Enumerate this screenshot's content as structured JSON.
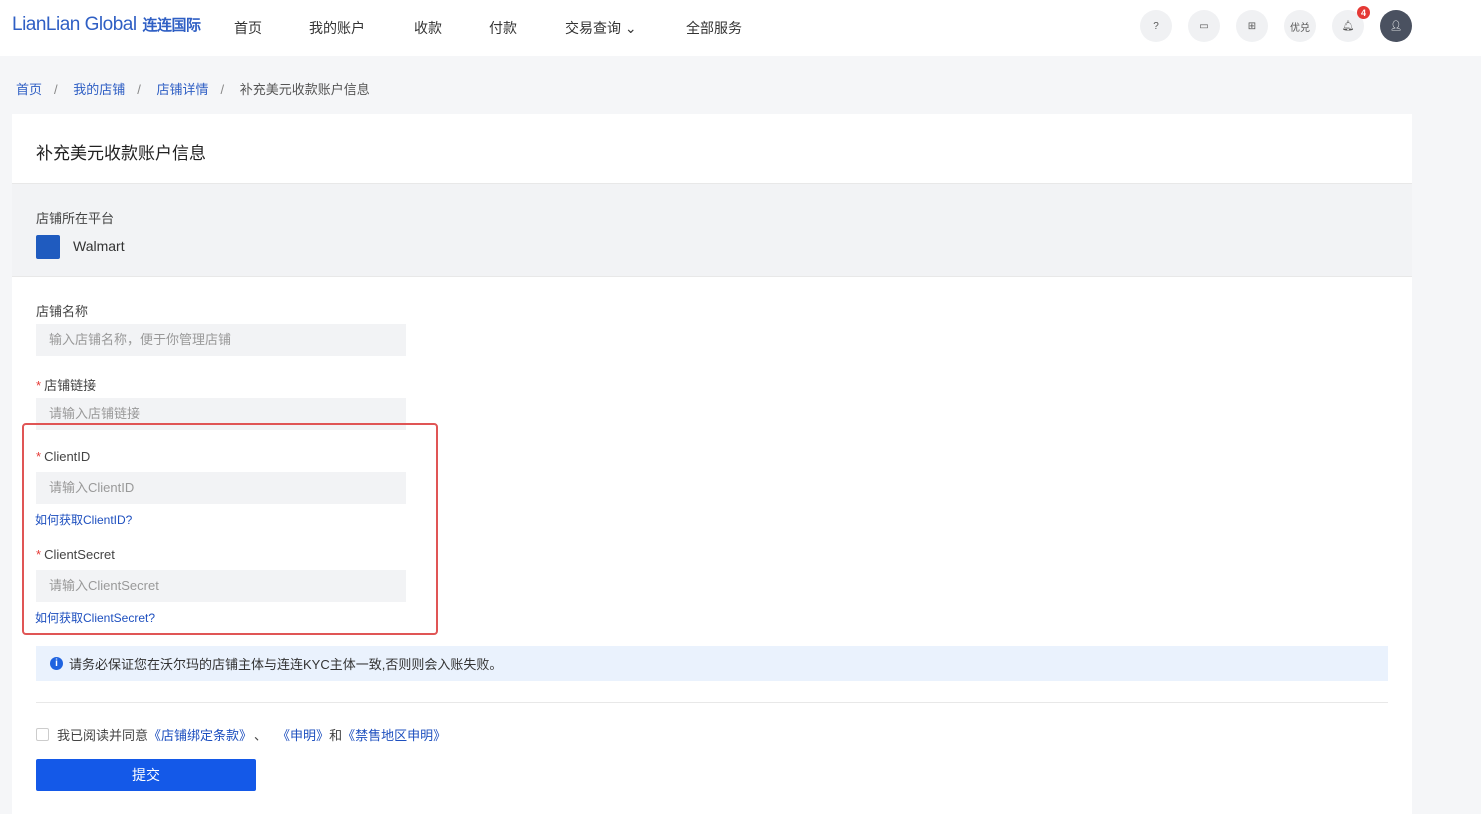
{
  "brand": {
    "logo_en": "LianLian Global",
    "logo_cn": "连连国际"
  },
  "nav": [
    "首页",
    "我的账户",
    "收款",
    "付款",
    "交易查询",
    "全部服务"
  ],
  "header": {
    "redeem": "优兑",
    "notif_count": "4"
  },
  "breadcrumb": [
    "首页",
    "我的店铺",
    "店铺详情",
    "补充美元收款账户信息"
  ],
  "page_title": "补充美元收款账户信息",
  "platform": {
    "label": "店铺所在平台",
    "name": "Walmart"
  },
  "form": {
    "store_name": {
      "label": "店铺名称",
      "placeholder": "输入店铺名称，便于你管理店铺"
    },
    "store_link": {
      "label": "店铺链接",
      "placeholder": "请输入店铺链接"
    },
    "client_id": {
      "label": "ClientID",
      "placeholder": "请输入ClientID",
      "help": "如何获取ClientID?"
    },
    "client_secret": {
      "label": "ClientSecret",
      "placeholder": "请输入ClientSecret",
      "help": "如何获取ClientSecret?"
    }
  },
  "notice": "请务必保证您在沃尔玛的店铺主体与连连KYC主体一致,否则则会入账失败。",
  "agree": {
    "prefix": "我已阅读并同意",
    "terms": "《店铺绑定条款》",
    "sep": "、",
    "statement": "《申明》",
    "and": "和",
    "prohibited": "《禁售地区申明》"
  },
  "submit": "提交"
}
